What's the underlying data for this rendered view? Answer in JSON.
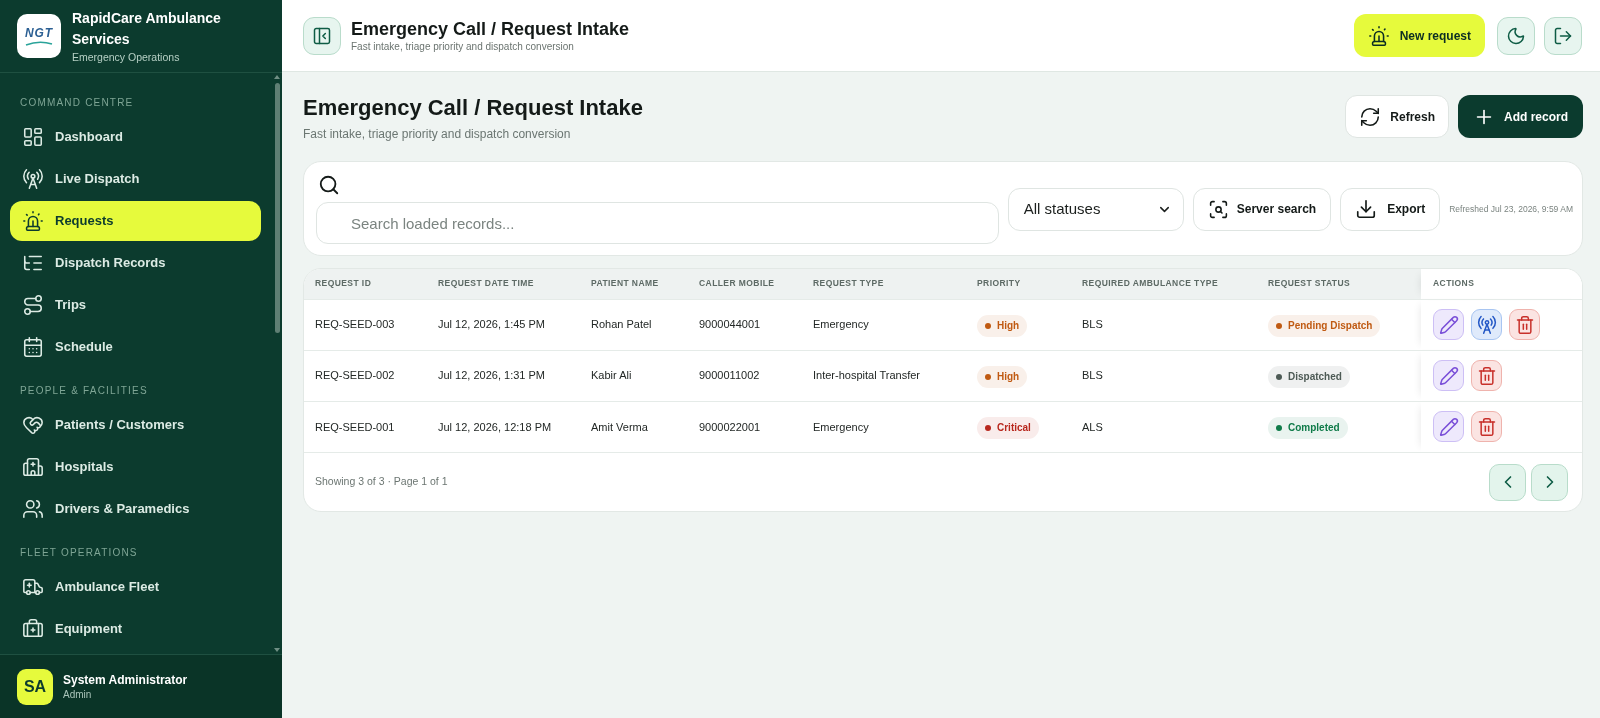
{
  "sidebar": {
    "brand": {
      "logo_text": "NGT",
      "name": "RapidCare Ambulance Services",
      "subtitle": "Emergency Operations"
    },
    "sections": [
      {
        "label": "COMMAND CENTRE",
        "items": [
          {
            "label": "Dashboard",
            "selected": false
          },
          {
            "label": "Live Dispatch",
            "selected": false
          },
          {
            "label": "Requests",
            "selected": true
          },
          {
            "label": "Dispatch Records",
            "selected": false
          },
          {
            "label": "Trips",
            "selected": false
          },
          {
            "label": "Schedule",
            "selected": false
          }
        ]
      },
      {
        "label": "PEOPLE & FACILITIES",
        "items": [
          {
            "label": "Patients / Customers",
            "selected": false
          },
          {
            "label": "Hospitals",
            "selected": false
          },
          {
            "label": "Drivers & Paramedics",
            "selected": false
          }
        ]
      },
      {
        "label": "FLEET OPERATIONS",
        "items": [
          {
            "label": "Ambulance Fleet",
            "selected": false
          },
          {
            "label": "Equipment",
            "selected": false
          }
        ]
      }
    ],
    "user": {
      "initials": "SA",
      "name": "System Administrator",
      "role": "Admin"
    }
  },
  "topbar": {
    "title": "Emergency Call / Request Intake",
    "subtitle": "Fast intake, triage priority and dispatch conversion",
    "new_request_button": "New request"
  },
  "page": {
    "title": "Emergency Call / Request Intake",
    "subtitle": "Fast intake, triage priority and dispatch conversion",
    "refresh_button": "Refresh",
    "add_button": "Add record"
  },
  "filters": {
    "search": {
      "placeholder": "Search loaded records..."
    },
    "status_select": {
      "value": "All statuses"
    },
    "server_search_button": "Server search",
    "export_button": "Export",
    "refreshed": "Refreshed Jul 23, 2026, 9:59 AM"
  },
  "table": {
    "columns": [
      "REQUEST ID",
      "REQUEST DATE TIME",
      "PATIENT NAME",
      "CALLER MOBILE",
      "REQUEST TYPE",
      "PRIORITY",
      "REQUIRED AMBULANCE TYPE",
      "REQUEST STATUS",
      "ACTIONS"
    ],
    "rows": [
      {
        "request_id": "REQ-SEED-003",
        "request_date_time": "Jul 12, 2026, 1:45 PM",
        "patient_name": "Rohan Patel",
        "caller_mobile": "9000044001",
        "request_type": "Emergency",
        "priority": {
          "label": "High",
          "color": "#c05a12"
        },
        "required_ambulance_type": "BLS",
        "request_status": {
          "label": "Pending Dispatch",
          "color": "#c05a12"
        },
        "actions": [
          {
            "kind": "edit"
          },
          {
            "kind": "dispatch"
          },
          {
            "kind": "delete"
          }
        ]
      },
      {
        "request_id": "REQ-SEED-002",
        "request_date_time": "Jul 12, 2026, 1:31 PM",
        "patient_name": "Kabir Ali",
        "caller_mobile": "9000011002",
        "request_type": "Inter-hospital Transfer",
        "priority": {
          "label": "High",
          "color": "#c05a12"
        },
        "required_ambulance_type": "BLS",
        "request_status": {
          "label": "Dispatched",
          "color": "#4d5a55"
        },
        "actions": [
          {
            "kind": "edit"
          },
          {
            "kind": "delete"
          }
        ]
      },
      {
        "request_id": "REQ-SEED-001",
        "request_date_time": "Jul 12, 2026, 12:18 PM",
        "patient_name": "Amit Verma",
        "caller_mobile": "9000022001",
        "request_type": "Emergency",
        "priority": {
          "label": "Critical",
          "color": "#b8271d"
        },
        "required_ambulance_type": "ALS",
        "request_status": {
          "label": "Completed",
          "color": "#0f7b49"
        },
        "actions": [
          {
            "kind": "edit"
          },
          {
            "kind": "delete"
          }
        ]
      }
    ],
    "footer": "Showing 3 of 3 · Page 1 of 1"
  }
}
